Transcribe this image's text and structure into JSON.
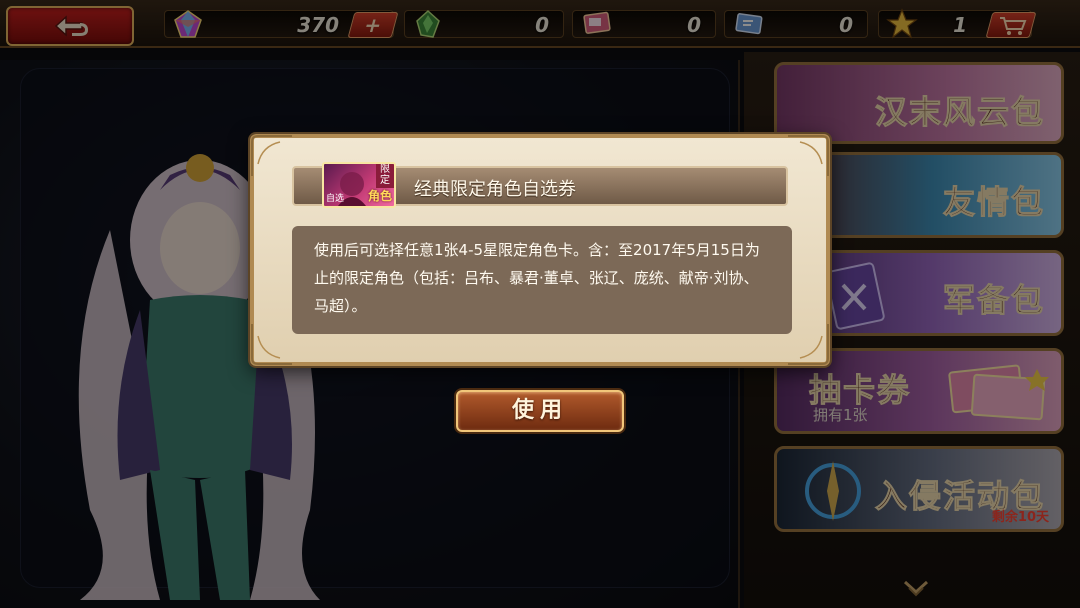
{
  "topbar": {
    "resources": [
      {
        "name": "gem",
        "value": "370",
        "action": "+"
      },
      {
        "name": "green-crystal",
        "value": "0"
      },
      {
        "name": "card-ticket",
        "value": "0"
      },
      {
        "name": "blue-ticket",
        "value": "0"
      },
      {
        "name": "star",
        "value": "1"
      }
    ]
  },
  "shop": {
    "packs": [
      {
        "title": "汉末风云包"
      },
      {
        "title": "友情包"
      },
      {
        "title": "军备包"
      },
      {
        "title": "抽卡券",
        "sub": "拥有1张"
      },
      {
        "title": "入侵活动包",
        "remaining": "剩余10天"
      }
    ]
  },
  "modal": {
    "title": "经典限定角色自选券",
    "card": {
      "tag_top": "限定",
      "tag_main": "角色",
      "tag_side": "自选"
    },
    "description": "使用后可选择任意1张4-5星限定角色卡。含：至2017年5月15日为止的限定角色（包括：吕布、暴君·董卓、张辽、庞统、献帝·刘协、马超）。"
  },
  "use_button": {
    "label": "使用"
  },
  "colors": {
    "accent_gold": "#b08a52",
    "button_red": "#c8201e",
    "remaining_red": "#ff4434"
  }
}
